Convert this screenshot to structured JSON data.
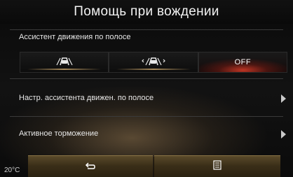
{
  "header": {
    "title": "Помощь при вождении"
  },
  "lane_assist": {
    "label": "Ассистент движения по полосе",
    "options": [
      {
        "icon": "lane-assist-car-icon",
        "label": ""
      },
      {
        "icon": "lane-assist-car-alert-icon",
        "label": ""
      },
      {
        "icon": "",
        "label": "OFF"
      }
    ],
    "selected": "OFF"
  },
  "menu": [
    {
      "label": "Настр. ассистента движен. по полосе"
    },
    {
      "label": "Активное торможение"
    }
  ],
  "bottom_bar": {
    "temperature": "20°C",
    "back_icon": "back-arrow-icon",
    "menu_icon": "list-menu-icon"
  },
  "colors": {
    "accent_gold": "#a88a5a",
    "off_highlight": "#dc3c28"
  }
}
